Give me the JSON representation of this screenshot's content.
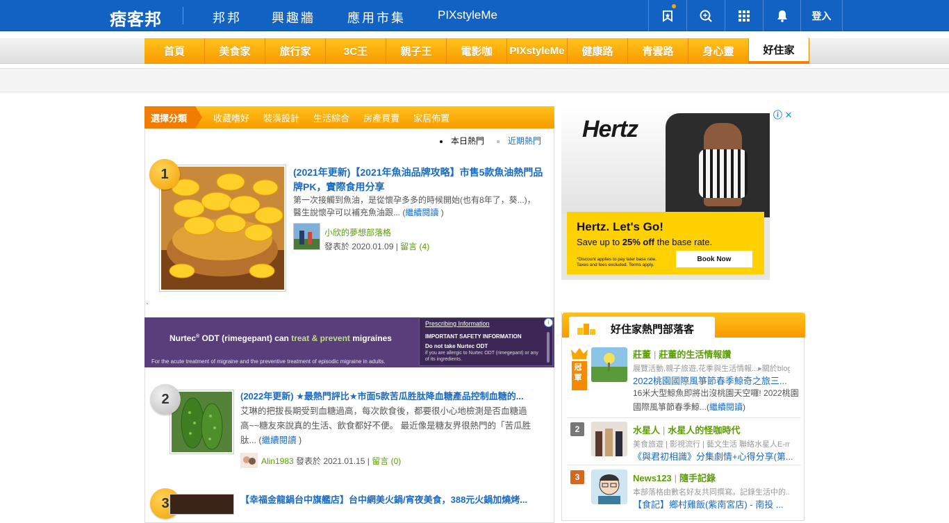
{
  "header": {
    "logo": "痞客邦",
    "nav": [
      "邦邦",
      "興趣牆",
      "應用市集",
      "PIXstyleMe"
    ],
    "login": "登入"
  },
  "channels": [
    "首頁",
    "美食家",
    "旅行家",
    "3C王",
    "親子王",
    "電影咖",
    "PIXstyleMe",
    "健康路",
    "青雲路",
    "身心靈",
    "好住家"
  ],
  "active_channel": "好住家",
  "categories": {
    "label": "選擇分類",
    "items": [
      "收藏嗜好",
      "裝潢設計",
      "生活綜合",
      "房產買賣",
      "家居佈置"
    ]
  },
  "hot_tabs": {
    "today": "本日熱門",
    "recent": "近期熱門"
  },
  "articles": [
    {
      "rank": "1",
      "title": "(2021年更新)【2021年魚油品牌攻略】市售5款魚油熱門品牌PK，實際食用分享",
      "desc": "第一次接觸到魚油，是從懷孕多多的時候開始(也有8年了，葵...)，醫生說懷孕可以補充魚油跟... (",
      "more": "繼續閱讀",
      "desc_end": " )",
      "author": "小欣的夢想部落格",
      "posted": "發表於 2020.01.09 | ",
      "comments": "留言 (4)"
    },
    {
      "rank": "2",
      "title": "(2022年更新) ★最熱門評比★市面5款苦瓜胜肽降血糖產品控制血糖的...",
      "desc": "艾琳的把拔長期受到血糖過高，每次飲食後，都要很小心地檢測是否血糖過高~~糖友來說真的生活、飲食都好不便。 最近像是糖友界很熱門的「苦瓜胜肽... (",
      "more": "繼續閱讀",
      "desc_end": " )",
      "author": "Alin1983",
      "posted": " 發表於 2021.01.15 | ",
      "comments": "留言 (0)"
    },
    {
      "rank": "3",
      "title": "【幸福金龍鍋台中旗艦店】台中網美火鍋/宵夜美食，388元火鍋加燒烤..."
    }
  ],
  "stray_char": "`",
  "nurtec_ad": {
    "headline_a": "Nurtec",
    "headline_reg": "®",
    "headline_b": " ODT (rimegepant) can ",
    "headline_treat": "treat & prevent",
    "headline_c": " migraines",
    "fine": "For the acute treatment of migraine and the preventive treatment of episodic migraine in adults.",
    "prescribing": "Prescribing Information",
    "important": "IMPORTANT SAFETY INFORMATION",
    "donot": "Do not take Nurtec ODT",
    "allergy": "if you are allergic to Nurtec ODT (rimegepant) or any of its ingredients."
  },
  "hertz_ad": {
    "brand": "Hertz",
    "title": "Hertz. Let's Go!",
    "sub_a": "Save up to ",
    "sub_b": "25% off",
    "sub_c": " the base rate.",
    "fine": "*Discount applies to pay later base rate. Taxes and fees excluded. Terms apply.",
    "button": "Book Now"
  },
  "panel": {
    "title": "好住家熱門部落客",
    "bloggers": [
      {
        "rank": "冠軍",
        "name": "莊董",
        "blog": "莊董的生活情報讚",
        "desc": "展覽活動,親子旅遊,花季與生活情報...▸關於blog...",
        "post": "2022桃園國際風箏節春季鯨奇之旅三...",
        "text": "16米大型鯨魚即將出沒桃園天空囉! 2022桃園國際風箏節春季鯨...(",
        "more": "繼續閱讀",
        "text_end": ")"
      },
      {
        "rank": "2",
        "name": "水星人",
        "blog": "水星人的怪咖時代",
        "desc": "美食旅遊 | 影視流行 | 藝文生活 聯絡水星人E-m...",
        "post": "《與君初相識》分集劇情+心得分享(第..."
      },
      {
        "rank": "3",
        "name": "News123",
        "blog": "隨手記錄",
        "desc": "本部落格由數名好友共同撰寫。記錄生活中的...",
        "post": "【食記】鄉村雞飯(紫南宮店) - 南投 ..."
      }
    ]
  },
  "colors": {
    "topbar": "#1262c4",
    "orange": "#f99a00",
    "link": "#1a6ac2",
    "green": "#5a9e00"
  }
}
